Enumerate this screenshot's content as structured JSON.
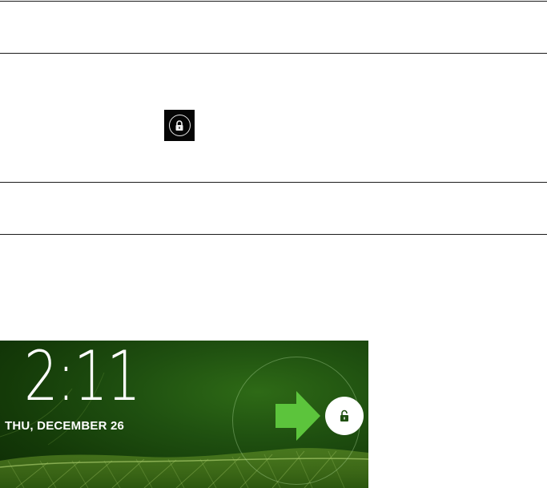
{
  "lock_icon_table": {
    "icon": "lock-icon"
  },
  "lockscreen": {
    "time": "2:11",
    "date": "THU, DECEMBER 26",
    "unlock_icon": "unlock-icon",
    "arrow_icon": "arrow-right-icon",
    "colors": {
      "background": "#1f5010",
      "arrow": "#5cc43c",
      "text": "#ffffff"
    }
  }
}
